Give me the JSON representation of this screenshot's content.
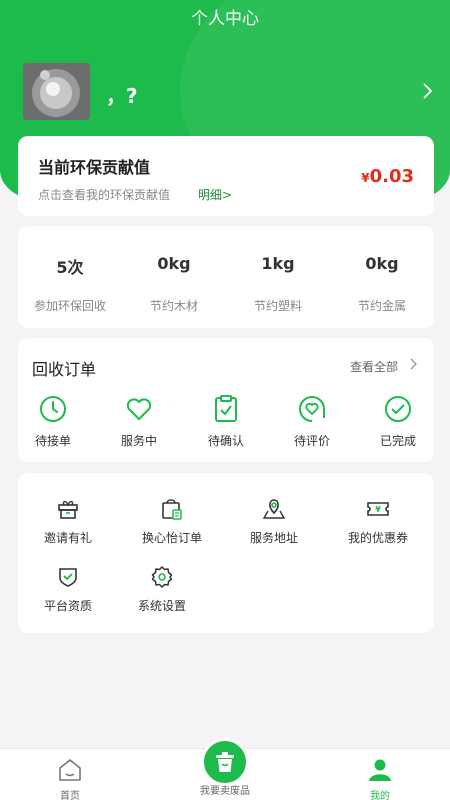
{
  "header": {
    "title": "个人中心",
    "nickname": "，?"
  },
  "eco": {
    "title": "当前环保贡献值",
    "subtitle": "点击查看我的环保贡献值",
    "detail_link": "明细>",
    "currency": "¥",
    "value": "0.03"
  },
  "stats": [
    {
      "value": "5次",
      "label": "参加环保回收"
    },
    {
      "value": "0kg",
      "label": "节约木材"
    },
    {
      "value": "1kg",
      "label": "节约塑料"
    },
    {
      "value": "0kg",
      "label": "节约金属"
    }
  ],
  "orders": {
    "title": "回收订单",
    "view_all": "查看全部",
    "items": [
      {
        "label": "待接单",
        "icon": "clock-icon"
      },
      {
        "label": "服务中",
        "icon": "heart-icon"
      },
      {
        "label": "待确认",
        "icon": "clipboard-check-icon"
      },
      {
        "label": "待评价",
        "icon": "heart-comment-icon"
      },
      {
        "label": "已完成",
        "icon": "check-circle-icon"
      }
    ]
  },
  "tools": [
    {
      "label": "邀请有礼",
      "icon": "gift-icon"
    },
    {
      "label": "换心怡订单",
      "icon": "shopping-bag-icon"
    },
    {
      "label": "服务地址",
      "icon": "location-pin-icon"
    },
    {
      "label": "我的优惠券",
      "icon": "coupon-icon"
    },
    {
      "label": "平台资质",
      "icon": "shield-icon"
    },
    {
      "label": "系统设置",
      "icon": "settings-gear-icon"
    }
  ],
  "tabbar": {
    "home": "首页",
    "sell": "我要卖废品",
    "mine": "我的"
  },
  "colors": {
    "brand": "#1dbb4b",
    "price": "#e02d1b"
  }
}
